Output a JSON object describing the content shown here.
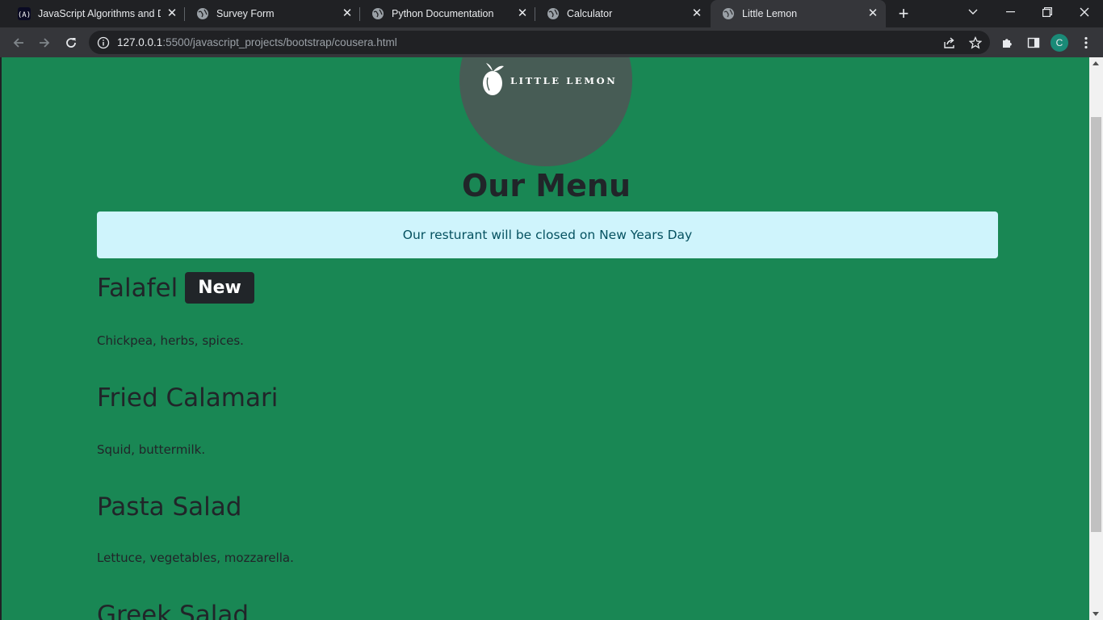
{
  "browser": {
    "tabs": [
      {
        "title": "JavaScript Algorithms and Da",
        "icon": "freecodecamp-icon"
      },
      {
        "title": "Survey Form",
        "icon": "globe-icon"
      },
      {
        "title": "Python Documentation",
        "icon": "globe-icon"
      },
      {
        "title": "Calculator",
        "icon": "globe-icon"
      },
      {
        "title": "Little Lemon",
        "icon": "globe-icon",
        "active": true
      }
    ],
    "url_host": "127.0.0.1",
    "url_rest": ":5500/javascript_projects/bootstrap/cousera.html",
    "profile_initial": "C"
  },
  "page": {
    "logo_text": "LITTLE LEMON",
    "heading": "Our Menu",
    "alert": "Our resturant will be closed on New Years Day",
    "items": [
      {
        "name": "Falafel",
        "badge": "New",
        "description": "Chickpea, herbs, spices."
      },
      {
        "name": "Fried Calamari",
        "description": "Squid, buttermilk."
      },
      {
        "name": "Pasta Salad",
        "description": "Lettuce, vegetables, mozzarella."
      },
      {
        "name": "Greek Salad"
      }
    ]
  },
  "colors": {
    "page_bg": "#198754",
    "logo_circle": "#475c55",
    "alert_bg": "#cff4fc",
    "badge_bg": "#212529"
  }
}
